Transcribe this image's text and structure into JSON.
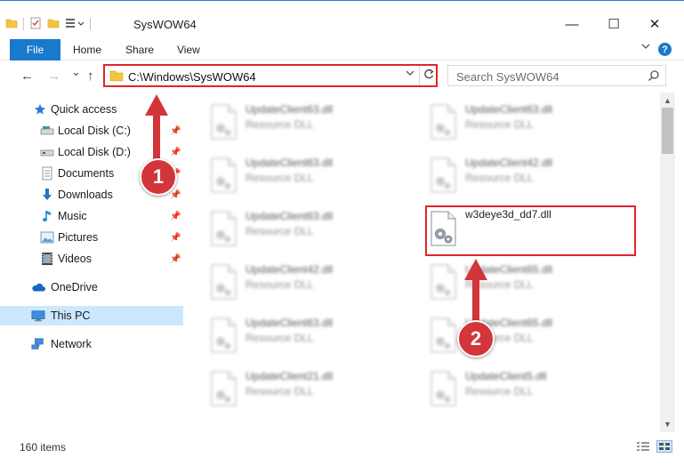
{
  "window": {
    "title": "SysWOW64",
    "accent_color": "#1979ca",
    "controls": {
      "minimize": "—",
      "maximize": "☐",
      "close": "✕"
    }
  },
  "ribbon": {
    "tabs": [
      "File",
      "Home",
      "Share",
      "View"
    ]
  },
  "nav_bar": {
    "back_symbol": "←",
    "forward_symbol": "→",
    "recent_symbol": "⌄",
    "up_symbol": "↑",
    "address": "C:\\Windows\\SysWOW64",
    "search_placeholder": "Search SysWOW64"
  },
  "sidebar": {
    "items": [
      {
        "label": "Quick access",
        "icon": "star-icon"
      },
      {
        "label": "Local Disk (C:)",
        "icon": "drive-icon",
        "pinned": true
      },
      {
        "label": "Local Disk (D:)",
        "icon": "drive-icon",
        "pinned": true
      },
      {
        "label": "Documents",
        "icon": "document-icon",
        "pinned": true
      },
      {
        "label": "Downloads",
        "icon": "download-icon",
        "pinned": true
      },
      {
        "label": "Music",
        "icon": "music-icon",
        "pinned": true
      },
      {
        "label": "Pictures",
        "icon": "picture-icon",
        "pinned": true
      },
      {
        "label": "Videos",
        "icon": "video-icon",
        "pinned": true
      },
      {
        "label": "OneDrive",
        "icon": "cloud-icon"
      },
      {
        "label": "This PC",
        "icon": "computer-icon",
        "selected": true
      },
      {
        "label": "Network",
        "icon": "network-icon"
      }
    ]
  },
  "files": {
    "left": [
      {
        "name": "UpdateClient63.dll",
        "type": "Resource DLL"
      },
      {
        "name": "UpdateClient63.dll",
        "type": "Resource DLL"
      },
      {
        "name": "UpdateClient63.dll",
        "type": "Resource DLL"
      },
      {
        "name": "UpdateClient42.dll",
        "type": "Resource DLL"
      },
      {
        "name": "UpdateClient63.dll",
        "type": "Resource DLL"
      },
      {
        "name": "UpdateClient21.dll",
        "type": "Resource DLL"
      }
    ],
    "right": [
      {
        "name": "UpdateClient63.dll",
        "type": "Resource DLL"
      },
      {
        "name": "UpdateClient42.dll",
        "type": "Resource DLL"
      },
      {
        "name": "w3deye3d_dd7.dll",
        "type": ""
      },
      {
        "name": "UpdateClient65.dll",
        "type": "Resource DLL"
      },
      {
        "name": "UpdateClient65.dll",
        "type": "Resource DLL"
      },
      {
        "name": "UpdateClient5.dll",
        "type": "Resource DLL"
      }
    ]
  },
  "annotations": {
    "step1": "1",
    "step2": "2",
    "color": "#e1242d"
  },
  "status": {
    "item_count": "160 items"
  }
}
